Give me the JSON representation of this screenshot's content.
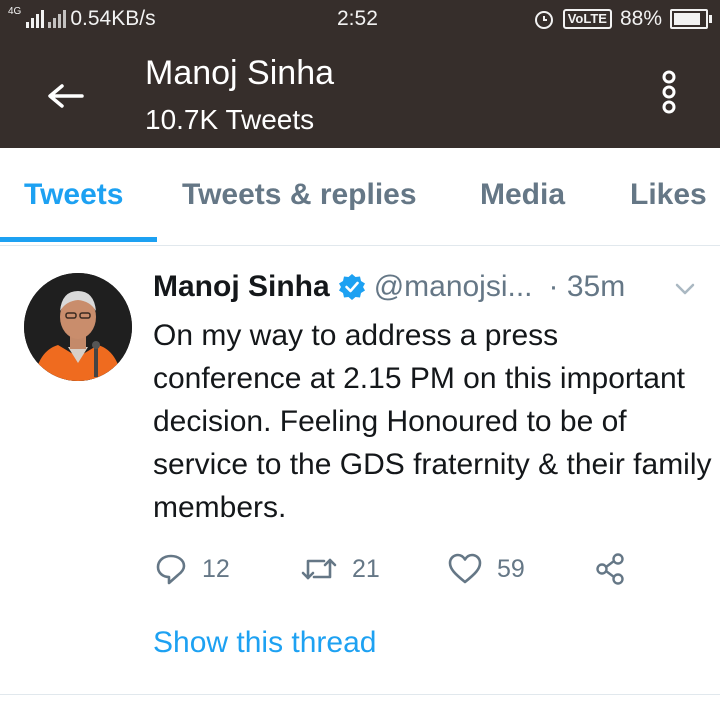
{
  "status_bar": {
    "network_label": "4G",
    "speed": "0.54KB/s",
    "time": "2:52",
    "volte": "VoLTE",
    "battery": "88%",
    "battery_level": 0.88
  },
  "header": {
    "title": "Manoj Sinha",
    "subtitle": "10.7K Tweets",
    "back_icon": "arrow-left-icon",
    "menu_icon": "more-vertical-icon"
  },
  "tabs": [
    {
      "label": "Tweets",
      "active": true
    },
    {
      "label": "Tweets & replies",
      "active": false
    },
    {
      "label": "Media",
      "active": false
    },
    {
      "label": "Likes",
      "active": false
    }
  ],
  "tweet": {
    "author_name": "Manoj Sinha",
    "handle": "@manojsi...",
    "time": "· 35m",
    "text": "On my way to address a press conference at 2.15 PM on this important decision. Feeling Honoured to be of service to the GDS fraternity & their family members.",
    "actions": {
      "reply_count": "12",
      "retweet_count": "21",
      "like_count": "59"
    },
    "thread_link": "Show this thread"
  },
  "colors": {
    "header_bg": "#362e2b",
    "accent": "#1da1f2",
    "muted": "#657786",
    "text": "#14171a"
  }
}
